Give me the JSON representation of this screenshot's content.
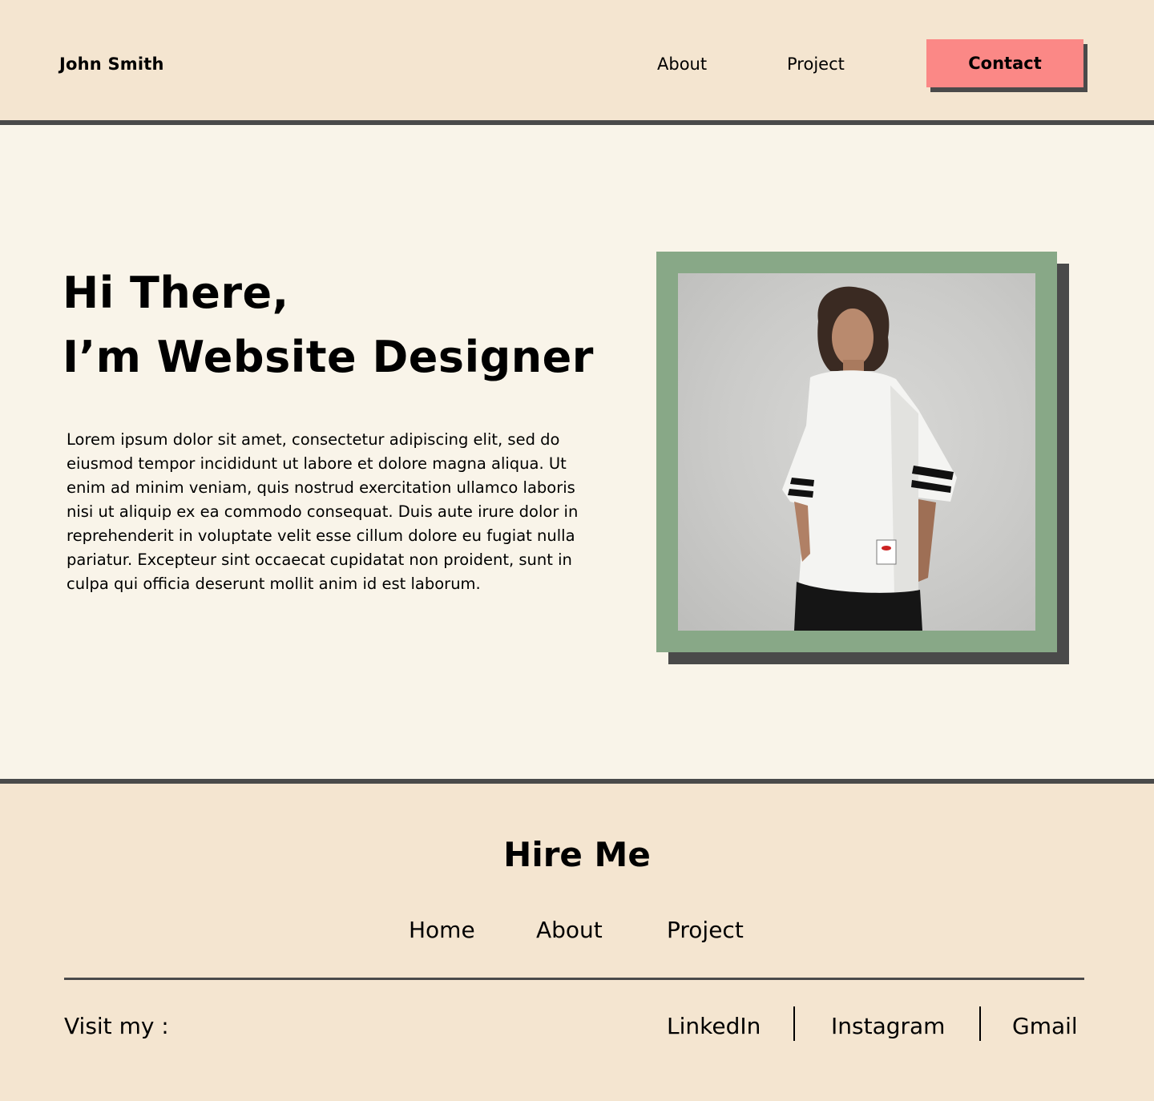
{
  "header": {
    "brand": "John Smith",
    "nav": {
      "about": "About",
      "project": "Project"
    },
    "contact_label": "Contact"
  },
  "hero": {
    "title_line1": "Hi There,",
    "title_line2": "I’m Website Designer",
    "body": "Lorem ipsum dolor sit amet, consectetur adipiscing elit, sed do eiusmod tempor incididunt ut labore et dolore magna aliqua. Ut enim ad minim veniam, quis nostrud exercitation ullamco laboris nisi ut aliquip ex ea commodo consequat. Duis aute irure dolor in reprehenderit in voluptate velit esse cillum dolore eu fugiat nulla pariatur. Excepteur sint occaecat cupidatat non proident, sunt in culpa qui officia deserunt mollit anim id est laborum."
  },
  "footer": {
    "heading": "Hire Me",
    "nav": {
      "home": "Home",
      "about": "About",
      "project": "Project"
    },
    "visit_label": "Visit my :",
    "socials": {
      "linkedin": "LinkedIn",
      "instagram": "Instagram",
      "gmail": "Gmail"
    }
  },
  "colors": {
    "header_bg": "#f4e5d0",
    "hero_bg": "#f9f4e9",
    "contact_bg": "#fb8886",
    "frame_green": "#88a887",
    "shadow": "#4a4a4a"
  }
}
